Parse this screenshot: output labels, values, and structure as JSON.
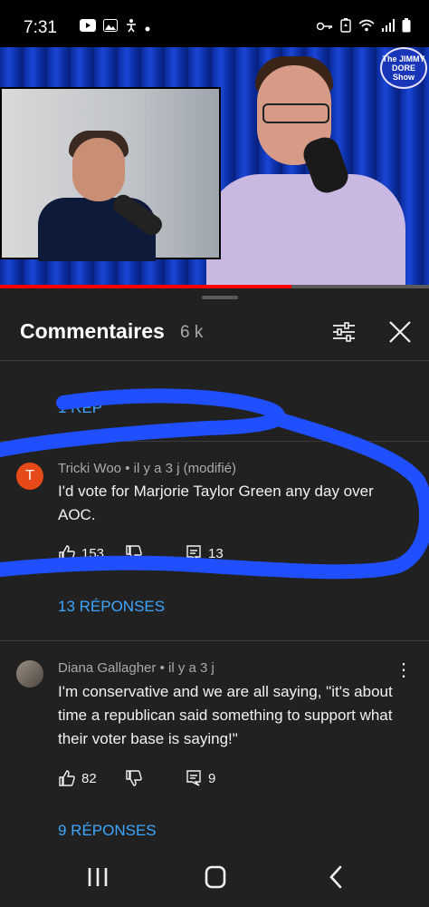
{
  "status_bar": {
    "time": "7:31",
    "left_icons": [
      "youtube-icon",
      "gallery-icon",
      "accessibility-icon",
      "dot-icon"
    ],
    "right_icons": [
      "key-icon",
      "battery-saver-icon",
      "wifi-icon",
      "signal-icon",
      "battery-icon"
    ]
  },
  "video": {
    "logo_text": "The JIMMY DORE Show",
    "progress_fraction": 0.68
  },
  "comments_header": {
    "title": "Commentaires",
    "count": "6 k"
  },
  "partial_reply_link": "1 RÉP",
  "comments": [
    {
      "avatar_letter": "T",
      "author": "Tricki Woo",
      "age": "il y a 3 j",
      "edited": "(modifié)",
      "text": "I'd vote for Marjorie Taylor Green any day over AOC.",
      "likes": "153",
      "replies_count": "13",
      "replies_link": "13 RÉPONSES"
    },
    {
      "author": "Diana Gallagher",
      "age": "il y a 3 j",
      "text": "I'm conservative and we are all saying, \"it's about time a republican said something to support what their voter base is saying!\"",
      "likes": "82",
      "replies_count": "9",
      "replies_link": "9 RÉPONSES"
    }
  ],
  "nav": [
    "recent-apps-icon",
    "home-icon",
    "back-icon"
  ],
  "colors": {
    "background": "#212121",
    "link": "#3ea6ff",
    "scribble": "#1f4fff",
    "avatar_t": "#e64a19",
    "progress": "#ff0000"
  }
}
